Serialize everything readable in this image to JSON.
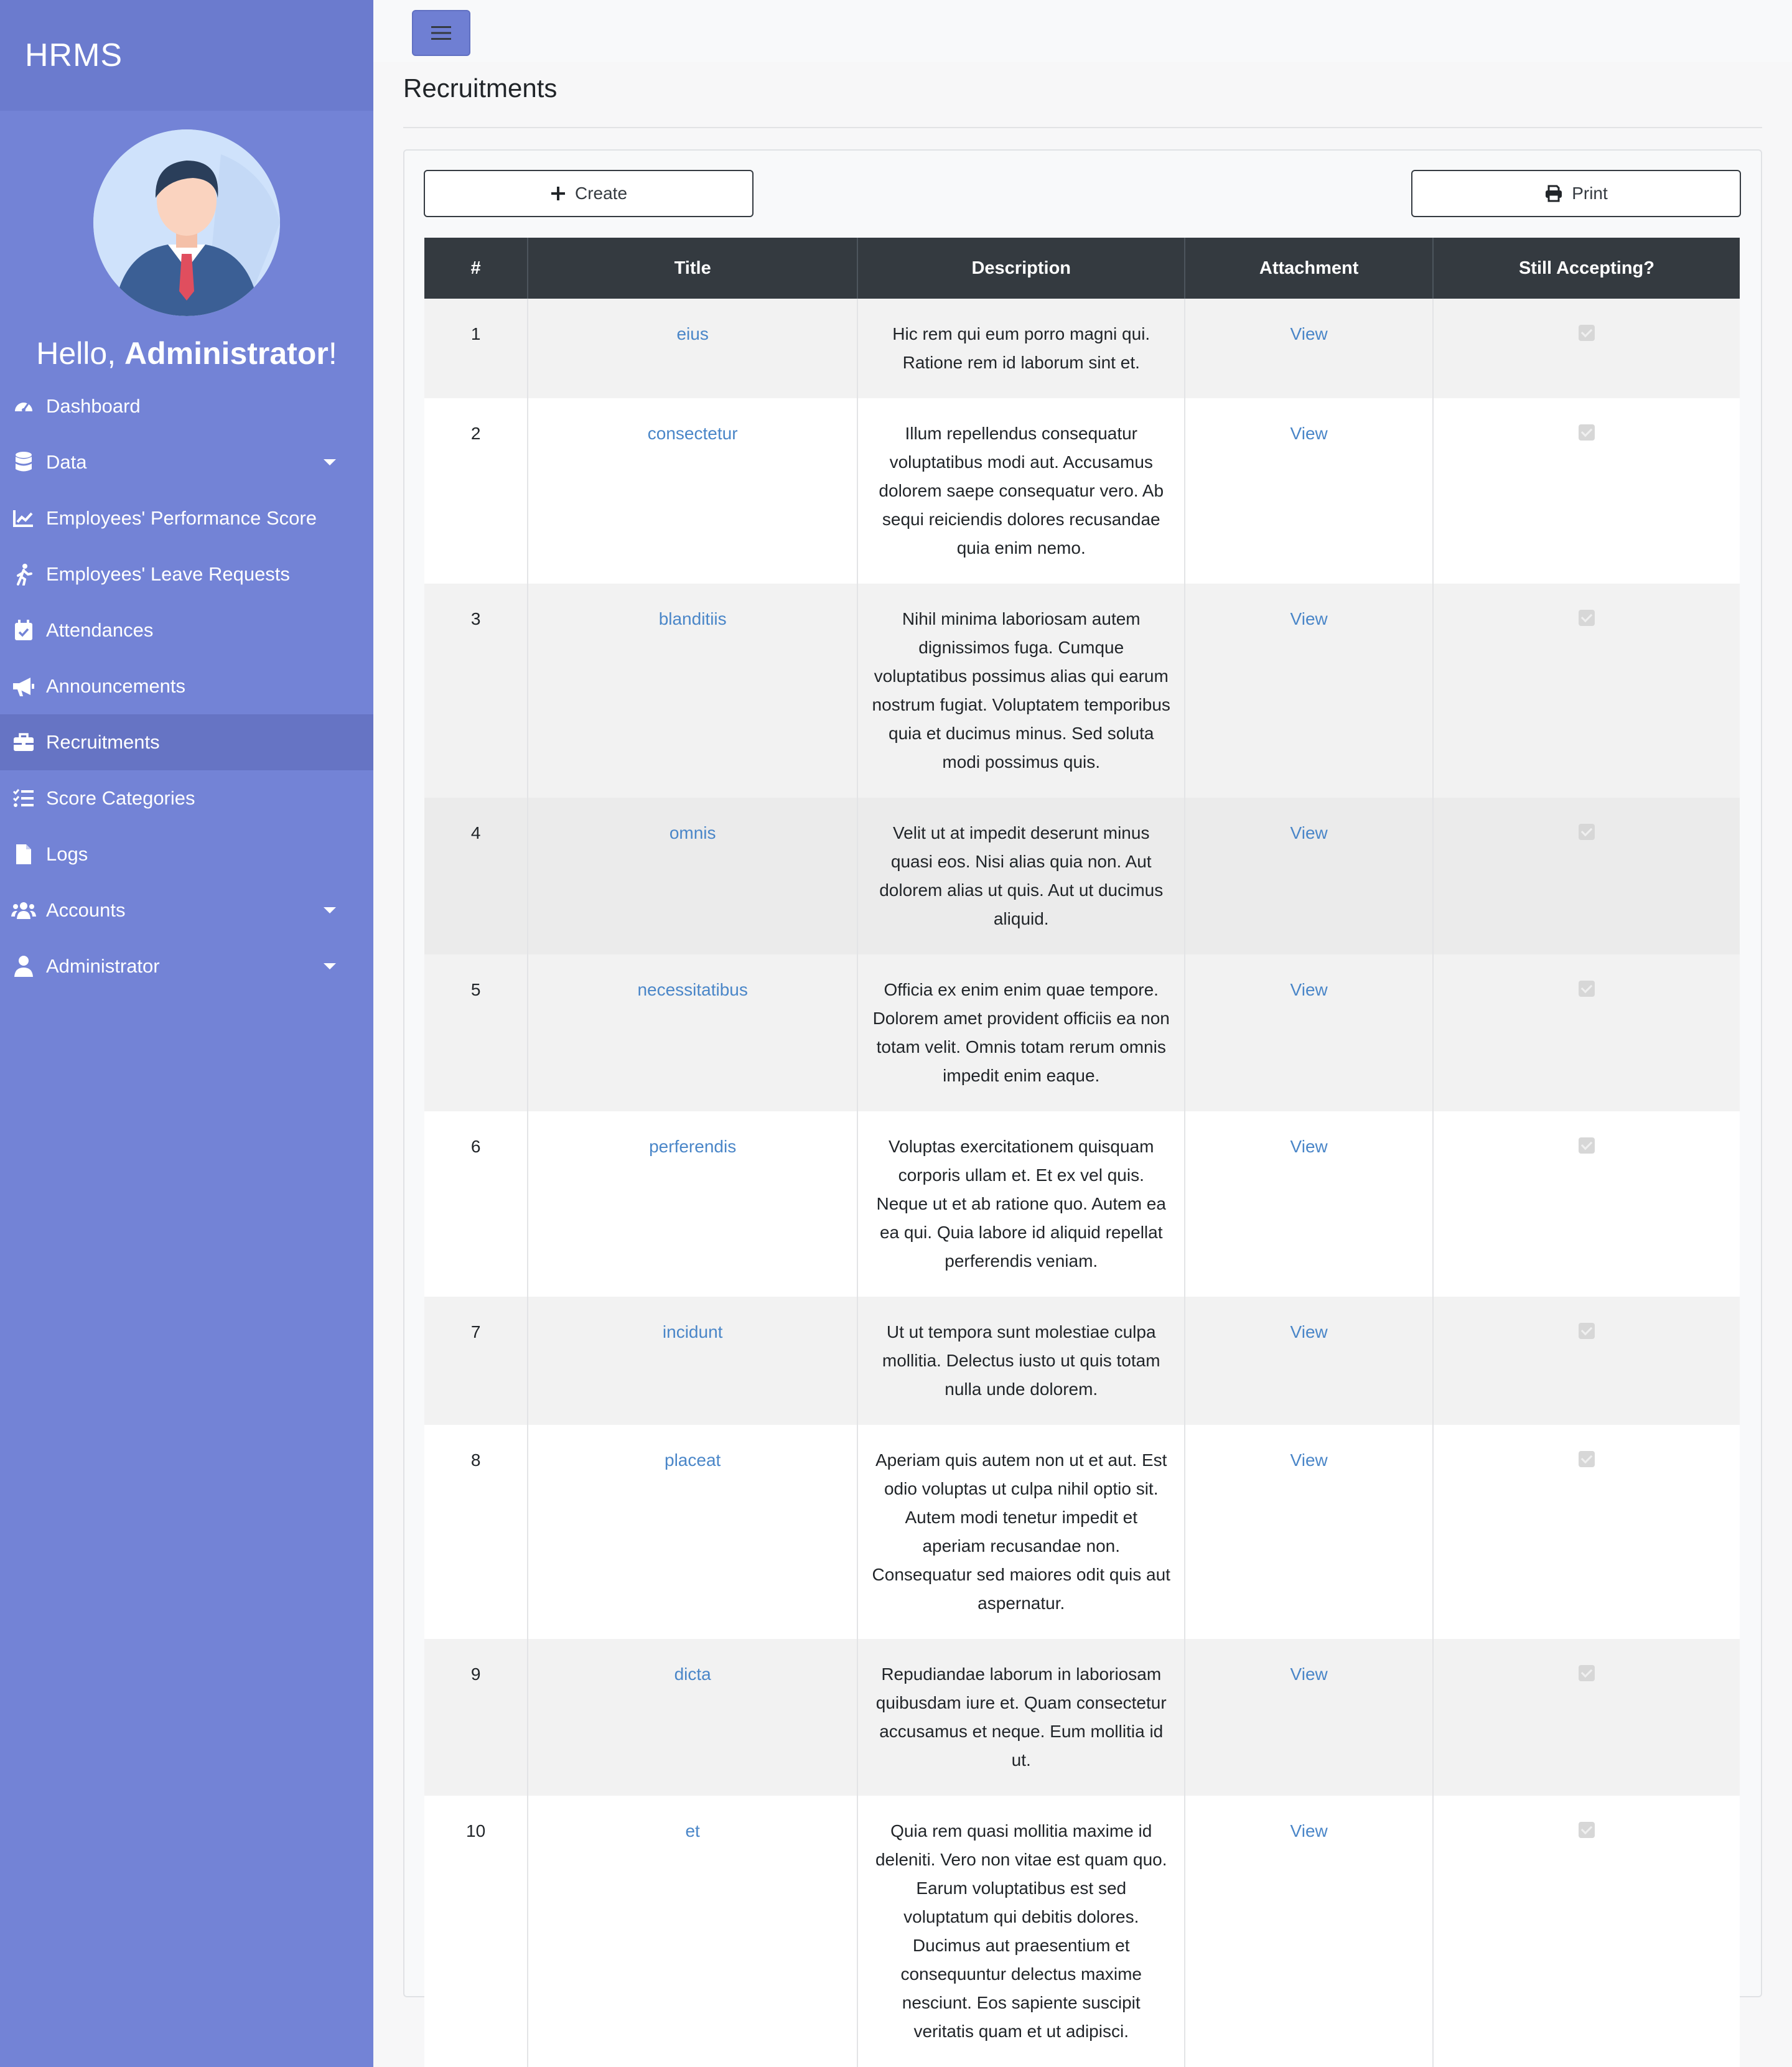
{
  "app": {
    "brand": "HRMS",
    "greeting_prefix": "Hello,",
    "user_name": "Administrator",
    "greeting_suffix": "!"
  },
  "sidebar": {
    "items": [
      {
        "label": "Dashboard",
        "icon": "gauge-icon",
        "dropdown": false
      },
      {
        "label": "Data",
        "icon": "database-icon",
        "dropdown": true
      },
      {
        "label": "Employees' Performance Score",
        "icon": "chart-line-icon",
        "dropdown": false
      },
      {
        "label": "Employees' Leave Requests",
        "icon": "person-walking-icon",
        "dropdown": false
      },
      {
        "label": "Attendances",
        "icon": "calendar-check-icon",
        "dropdown": false
      },
      {
        "label": "Announcements",
        "icon": "megaphone-icon",
        "dropdown": false
      },
      {
        "label": "Recruitments",
        "icon": "briefcase-icon",
        "dropdown": false,
        "active": true
      },
      {
        "label": "Score Categories",
        "icon": "list-check-icon",
        "dropdown": false
      },
      {
        "label": "Logs",
        "icon": "file-icon",
        "dropdown": false
      },
      {
        "label": "Accounts",
        "icon": "users-icon",
        "dropdown": true
      },
      {
        "label": "Administrator",
        "icon": "user-icon",
        "dropdown": true
      }
    ]
  },
  "page": {
    "title": "Recruitments",
    "create_label": "Create",
    "print_label": "Print"
  },
  "table": {
    "headers": [
      "#",
      "Title",
      "Description",
      "Attachment",
      "Still Accepting?"
    ],
    "rows": [
      {
        "num": "1",
        "title": "eius",
        "desc": "Hic rem qui eum porro magni qui. Ratione rem id laborum sint et.",
        "attachment": "View",
        "accepting": true
      },
      {
        "num": "2",
        "title": "consectetur",
        "desc": "Illum repellendus consequatur voluptatibus modi aut. Accusamus dolorem saepe consequatur vero. Ab sequi reiciendis dolores recusandae quia enim nemo.",
        "attachment": "View",
        "accepting": true
      },
      {
        "num": "3",
        "title": "blanditiis",
        "desc": "Nihil minima laboriosam autem dignissimos fuga. Cumque voluptatibus possimus alias qui earum nostrum fugiat. Voluptatem temporibus quia et ducimus minus. Sed soluta modi possimus quis.",
        "attachment": "View",
        "accepting": true
      },
      {
        "num": "4",
        "title": "omnis",
        "desc": "Velit ut at impedit deserunt minus quasi eos. Nisi alias quia non. Aut dolorem alias ut quis. Aut ut ducimus aliquid.",
        "attachment": "View",
        "accepting": true
      },
      {
        "num": "5",
        "title": "necessitatibus",
        "desc": "Officia ex enim enim quae tempore. Dolorem amet provident officiis ea non totam velit. Omnis totam rerum omnis impedit enim eaque.",
        "attachment": "View",
        "accepting": true
      },
      {
        "num": "6",
        "title": "perferendis",
        "desc": "Voluptas exercitationem quisquam corporis ullam et. Et ex vel quis. Neque ut et ab ratione quo. Autem ea ea qui. Quia labore id aliquid repellat perferendis veniam.",
        "attachment": "View",
        "accepting": true
      },
      {
        "num": "7",
        "title": "incidunt",
        "desc": "Ut ut tempora sunt molestiae culpa mollitia. Delectus iusto ut quis totam nulla unde dolorem.",
        "attachment": "View",
        "accepting": true
      },
      {
        "num": "8",
        "title": "placeat",
        "desc": "Aperiam quis autem non ut et aut. Est odio voluptas ut culpa nihil optio sit. Autem modi tenetur impedit et aperiam recusandae non. Consequatur sed maiores odit quis aut aspernatur.",
        "attachment": "View",
        "accepting": true
      },
      {
        "num": "9",
        "title": "dicta",
        "desc": "Repudiandae laborum in laboriosam quibusdam iure et. Quam consectetur accusamus et neque. Eum mollitia id ut.",
        "attachment": "View",
        "accepting": true
      },
      {
        "num": "10",
        "title": "et",
        "desc": "Quia rem quasi mollitia maxime id deleniti. Vero non vitae est quam quo. Earum voluptatibus est sed voluptatum qui debitis dolores. Ducimus aut praesentium et consequuntur delectus maxime nesciunt. Eos sapiente suscipit veritatis quam et ut adipisci.",
        "attachment": "View",
        "accepting": true
      }
    ]
  },
  "colors": {
    "sidebar_bg": "#7383d6",
    "sidebar_active": "#6674c4",
    "table_header": "#343a40",
    "link": "#4a86c8"
  }
}
